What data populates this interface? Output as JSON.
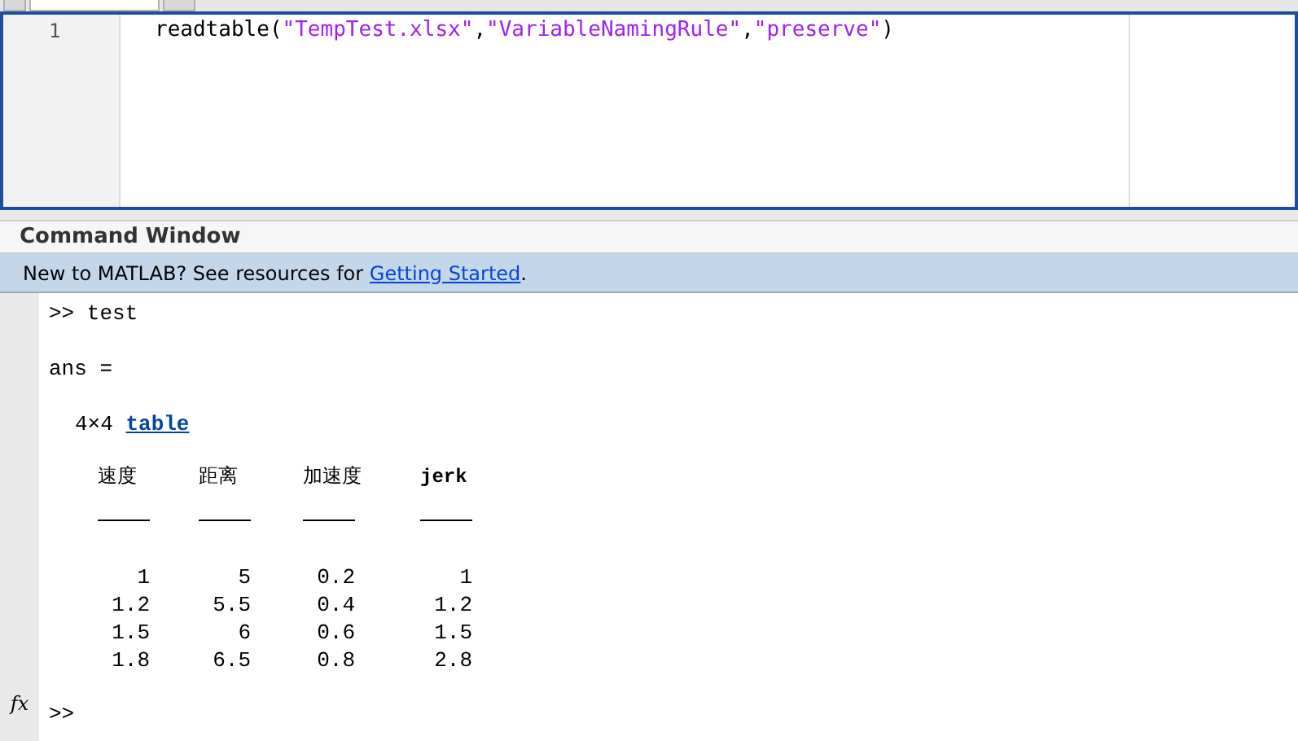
{
  "editor_tabs": [
    {
      "selected": false
    },
    {
      "selected": true
    },
    {
      "selected": false
    }
  ],
  "editor": {
    "line_numbers": [
      "1"
    ],
    "code": [
      {
        "kind": "plain",
        "text": "readtable("
      },
      {
        "kind": "string",
        "text": "\"TempTest.xlsx\""
      },
      {
        "kind": "plain",
        "text": ","
      },
      {
        "kind": "string",
        "text": "\"VariableNamingRule\""
      },
      {
        "kind": "plain",
        "text": ","
      },
      {
        "kind": "string",
        "text": "\"preserve\""
      },
      {
        "kind": "plain",
        "text": ")"
      }
    ]
  },
  "command_window": {
    "title": "Command Window",
    "banner": {
      "text": "New to MATLAB? See resources for ",
      "link": "Getting Started",
      "suffix": "."
    },
    "prompt": ">>",
    "command": "test",
    "ans": "ans =",
    "size": "4×4",
    "type_link": "table",
    "columns": [
      {
        "name": "速度",
        "bold": false
      },
      {
        "name": "距离",
        "bold": false
      },
      {
        "name": "加速度",
        "bold": false
      },
      {
        "name": "jerk",
        "bold": true
      }
    ],
    "rows": [
      [
        "1",
        "5",
        "0.2",
        "1"
      ],
      [
        "1.2",
        "5.5",
        "0.4",
        "1.2"
      ],
      [
        "1.5",
        "6",
        "0.6",
        "1.5"
      ],
      [
        "1.8",
        "6.5",
        "0.8",
        "2.8"
      ]
    ],
    "fx": "fx",
    "next_prompt": ">>"
  }
}
